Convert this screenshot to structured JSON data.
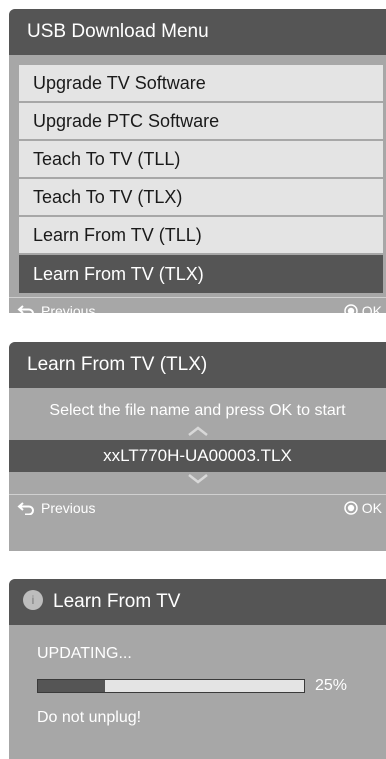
{
  "download_menu": {
    "title": "USB Download Menu",
    "items": [
      {
        "label": "Upgrade TV Software"
      },
      {
        "label": "Upgrade PTC Software"
      },
      {
        "label": "Teach To TV (TLL)"
      },
      {
        "label": "Teach To TV (TLX)"
      },
      {
        "label": "Learn From TV (TLL)"
      },
      {
        "label": "Learn From TV (TLX)",
        "selected": true
      }
    ],
    "footer": {
      "previous": "Previous",
      "ok": "OK"
    }
  },
  "file_select": {
    "title": "Learn From TV (TLX)",
    "instruction": "Select the file name and press OK to start",
    "filename": "xxLT770H-UA00003.TLX",
    "footer": {
      "previous": "Previous",
      "ok": "OK"
    }
  },
  "progress": {
    "title": "Learn From TV",
    "status": "UPDATING...",
    "percent_label": "25%",
    "percent_value": 25,
    "warning": "Do not unplug!"
  },
  "colors": {
    "panel_bg": "#a7a7a7",
    "header_bg": "#555555",
    "item_bg": "#e4e4e4",
    "text_light": "#ffffff"
  }
}
